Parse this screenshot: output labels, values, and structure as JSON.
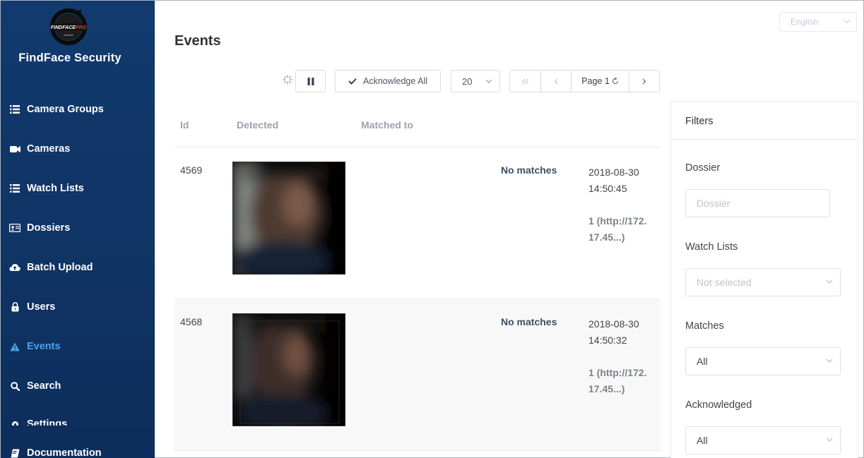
{
  "app": {
    "brand": "FindFace Security",
    "logo_text": "FINDFACEPRO",
    "language": "English"
  },
  "sidebar": {
    "items": [
      {
        "label": "Camera Groups",
        "icon": "list-icon"
      },
      {
        "label": "Cameras",
        "icon": "video-camera-icon"
      },
      {
        "label": "Watch Lists",
        "icon": "list-icon"
      },
      {
        "label": "Dossiers",
        "icon": "id-card-icon"
      },
      {
        "label": "Batch Upload",
        "icon": "cloud-upload-icon"
      },
      {
        "label": "Users",
        "icon": "user-lock-icon"
      },
      {
        "label": "Events",
        "icon": "warning-icon",
        "active": true
      },
      {
        "label": "Search",
        "icon": "search-icon"
      },
      {
        "label": "Settings",
        "icon": "gear-icon"
      },
      {
        "label": "Documentation",
        "icon": "book-icon"
      }
    ]
  },
  "page": {
    "title": "Events"
  },
  "toolbar": {
    "acknowledge_all": "Acknowledge All",
    "page_size": "20",
    "page_label": "Page 1"
  },
  "table": {
    "headers": {
      "id": "Id",
      "detected": "Detected",
      "matched_to": "Matched to"
    },
    "rows": [
      {
        "id": "4569",
        "match": "No matches",
        "date": "2018-08-30",
        "time": "14:50:45",
        "camera_line1": "1 (http://172.",
        "camera_line2": "17.45...)"
      },
      {
        "id": "4568",
        "match": "No matches",
        "date": "2018-08-30",
        "time": "14:50:32",
        "camera_line1": "1 (http://172.",
        "camera_line2": "17.45...)"
      }
    ]
  },
  "filters": {
    "title": "Filters",
    "dossier_label": "Dossier",
    "dossier_placeholder": "Dossier",
    "watch_lists_label": "Watch Lists",
    "watch_lists_value": "Not selected",
    "matches_label": "Matches",
    "matches_value": "All",
    "acknowledged_label": "Acknowledged",
    "acknowledged_value": "All"
  },
  "colors": {
    "sidebar_bg": "#103566",
    "active_nav": "#4aa3ea",
    "match_text": "#3f4e62"
  }
}
